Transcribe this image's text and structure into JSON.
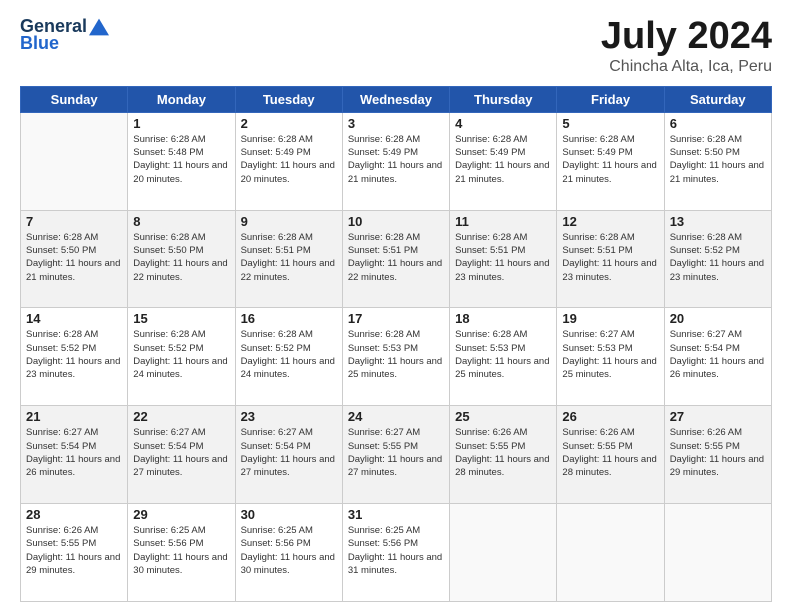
{
  "header": {
    "logo_general": "General",
    "logo_blue": "Blue",
    "month_title": "July 2024",
    "location": "Chincha Alta, Ica, Peru"
  },
  "weekdays": [
    "Sunday",
    "Monday",
    "Tuesday",
    "Wednesday",
    "Thursday",
    "Friday",
    "Saturday"
  ],
  "weeks": [
    [
      {
        "day": "",
        "sunrise": "",
        "sunset": "",
        "daylight": ""
      },
      {
        "day": "1",
        "sunrise": "Sunrise: 6:28 AM",
        "sunset": "Sunset: 5:48 PM",
        "daylight": "Daylight: 11 hours and 20 minutes."
      },
      {
        "day": "2",
        "sunrise": "Sunrise: 6:28 AM",
        "sunset": "Sunset: 5:49 PM",
        "daylight": "Daylight: 11 hours and 20 minutes."
      },
      {
        "day": "3",
        "sunrise": "Sunrise: 6:28 AM",
        "sunset": "Sunset: 5:49 PM",
        "daylight": "Daylight: 11 hours and 21 minutes."
      },
      {
        "day": "4",
        "sunrise": "Sunrise: 6:28 AM",
        "sunset": "Sunset: 5:49 PM",
        "daylight": "Daylight: 11 hours and 21 minutes."
      },
      {
        "day": "5",
        "sunrise": "Sunrise: 6:28 AM",
        "sunset": "Sunset: 5:49 PM",
        "daylight": "Daylight: 11 hours and 21 minutes."
      },
      {
        "day": "6",
        "sunrise": "Sunrise: 6:28 AM",
        "sunset": "Sunset: 5:50 PM",
        "daylight": "Daylight: 11 hours and 21 minutes."
      }
    ],
    [
      {
        "day": "7",
        "sunrise": "Sunrise: 6:28 AM",
        "sunset": "Sunset: 5:50 PM",
        "daylight": "Daylight: 11 hours and 21 minutes."
      },
      {
        "day": "8",
        "sunrise": "Sunrise: 6:28 AM",
        "sunset": "Sunset: 5:50 PM",
        "daylight": "Daylight: 11 hours and 22 minutes."
      },
      {
        "day": "9",
        "sunrise": "Sunrise: 6:28 AM",
        "sunset": "Sunset: 5:51 PM",
        "daylight": "Daylight: 11 hours and 22 minutes."
      },
      {
        "day": "10",
        "sunrise": "Sunrise: 6:28 AM",
        "sunset": "Sunset: 5:51 PM",
        "daylight": "Daylight: 11 hours and 22 minutes."
      },
      {
        "day": "11",
        "sunrise": "Sunrise: 6:28 AM",
        "sunset": "Sunset: 5:51 PM",
        "daylight": "Daylight: 11 hours and 23 minutes."
      },
      {
        "day": "12",
        "sunrise": "Sunrise: 6:28 AM",
        "sunset": "Sunset: 5:51 PM",
        "daylight": "Daylight: 11 hours and 23 minutes."
      },
      {
        "day": "13",
        "sunrise": "Sunrise: 6:28 AM",
        "sunset": "Sunset: 5:52 PM",
        "daylight": "Daylight: 11 hours and 23 minutes."
      }
    ],
    [
      {
        "day": "14",
        "sunrise": "Sunrise: 6:28 AM",
        "sunset": "Sunset: 5:52 PM",
        "daylight": "Daylight: 11 hours and 23 minutes."
      },
      {
        "day": "15",
        "sunrise": "Sunrise: 6:28 AM",
        "sunset": "Sunset: 5:52 PM",
        "daylight": "Daylight: 11 hours and 24 minutes."
      },
      {
        "day": "16",
        "sunrise": "Sunrise: 6:28 AM",
        "sunset": "Sunset: 5:52 PM",
        "daylight": "Daylight: 11 hours and 24 minutes."
      },
      {
        "day": "17",
        "sunrise": "Sunrise: 6:28 AM",
        "sunset": "Sunset: 5:53 PM",
        "daylight": "Daylight: 11 hours and 25 minutes."
      },
      {
        "day": "18",
        "sunrise": "Sunrise: 6:28 AM",
        "sunset": "Sunset: 5:53 PM",
        "daylight": "Daylight: 11 hours and 25 minutes."
      },
      {
        "day": "19",
        "sunrise": "Sunrise: 6:27 AM",
        "sunset": "Sunset: 5:53 PM",
        "daylight": "Daylight: 11 hours and 25 minutes."
      },
      {
        "day": "20",
        "sunrise": "Sunrise: 6:27 AM",
        "sunset": "Sunset: 5:54 PM",
        "daylight": "Daylight: 11 hours and 26 minutes."
      }
    ],
    [
      {
        "day": "21",
        "sunrise": "Sunrise: 6:27 AM",
        "sunset": "Sunset: 5:54 PM",
        "daylight": "Daylight: 11 hours and 26 minutes."
      },
      {
        "day": "22",
        "sunrise": "Sunrise: 6:27 AM",
        "sunset": "Sunset: 5:54 PM",
        "daylight": "Daylight: 11 hours and 27 minutes."
      },
      {
        "day": "23",
        "sunrise": "Sunrise: 6:27 AM",
        "sunset": "Sunset: 5:54 PM",
        "daylight": "Daylight: 11 hours and 27 minutes."
      },
      {
        "day": "24",
        "sunrise": "Sunrise: 6:27 AM",
        "sunset": "Sunset: 5:55 PM",
        "daylight": "Daylight: 11 hours and 27 minutes."
      },
      {
        "day": "25",
        "sunrise": "Sunrise: 6:26 AM",
        "sunset": "Sunset: 5:55 PM",
        "daylight": "Daylight: 11 hours and 28 minutes."
      },
      {
        "day": "26",
        "sunrise": "Sunrise: 6:26 AM",
        "sunset": "Sunset: 5:55 PM",
        "daylight": "Daylight: 11 hours and 28 minutes."
      },
      {
        "day": "27",
        "sunrise": "Sunrise: 6:26 AM",
        "sunset": "Sunset: 5:55 PM",
        "daylight": "Daylight: 11 hours and 29 minutes."
      }
    ],
    [
      {
        "day": "28",
        "sunrise": "Sunrise: 6:26 AM",
        "sunset": "Sunset: 5:55 PM",
        "daylight": "Daylight: 11 hours and 29 minutes."
      },
      {
        "day": "29",
        "sunrise": "Sunrise: 6:25 AM",
        "sunset": "Sunset: 5:56 PM",
        "daylight": "Daylight: 11 hours and 30 minutes."
      },
      {
        "day": "30",
        "sunrise": "Sunrise: 6:25 AM",
        "sunset": "Sunset: 5:56 PM",
        "daylight": "Daylight: 11 hours and 30 minutes."
      },
      {
        "day": "31",
        "sunrise": "Sunrise: 6:25 AM",
        "sunset": "Sunset: 5:56 PM",
        "daylight": "Daylight: 11 hours and 31 minutes."
      },
      {
        "day": "",
        "sunrise": "",
        "sunset": "",
        "daylight": ""
      },
      {
        "day": "",
        "sunrise": "",
        "sunset": "",
        "daylight": ""
      },
      {
        "day": "",
        "sunrise": "",
        "sunset": "",
        "daylight": ""
      }
    ]
  ]
}
